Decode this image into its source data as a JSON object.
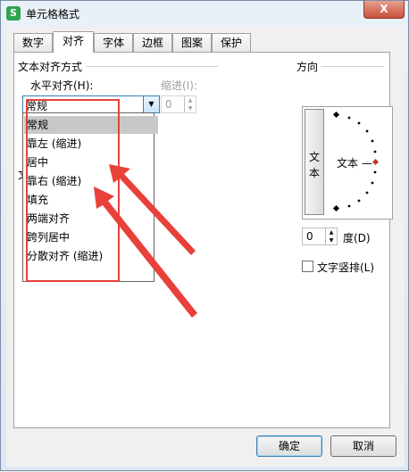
{
  "window": {
    "title": "单元格格式",
    "app_icon": "S",
    "close_label": "X"
  },
  "tabs": [
    {
      "label": "数字",
      "active": false
    },
    {
      "label": "对齐",
      "active": true
    },
    {
      "label": "字体",
      "active": false
    },
    {
      "label": "边框",
      "active": false
    },
    {
      "label": "图案",
      "active": false
    },
    {
      "label": "保护",
      "active": false
    }
  ],
  "alignment": {
    "group_label": "文本对齐方式",
    "horizontal_label": "水平对齐(H):",
    "horizontal_value": "常规",
    "indent_label": "缩进(I):",
    "indent_value": "0",
    "hidden_group_char": "文",
    "options": [
      "常规",
      "靠左 (缩进)",
      "居中",
      "靠右 (缩进)",
      "填充",
      "两端对齐",
      "跨列居中",
      "分散对齐 (缩进)"
    ],
    "selected_index": 0
  },
  "orientation": {
    "group_label": "方向",
    "vertical_text": [
      "文",
      "本"
    ],
    "dial_text": "文本 —",
    "degree_value": "0",
    "degree_label": "度(D)",
    "vertical_check_label": "文字竖排(L)",
    "vertical_checked": false
  },
  "buttons": {
    "ok": "确定",
    "cancel": "取消"
  },
  "annotation_color": "#e8413a"
}
